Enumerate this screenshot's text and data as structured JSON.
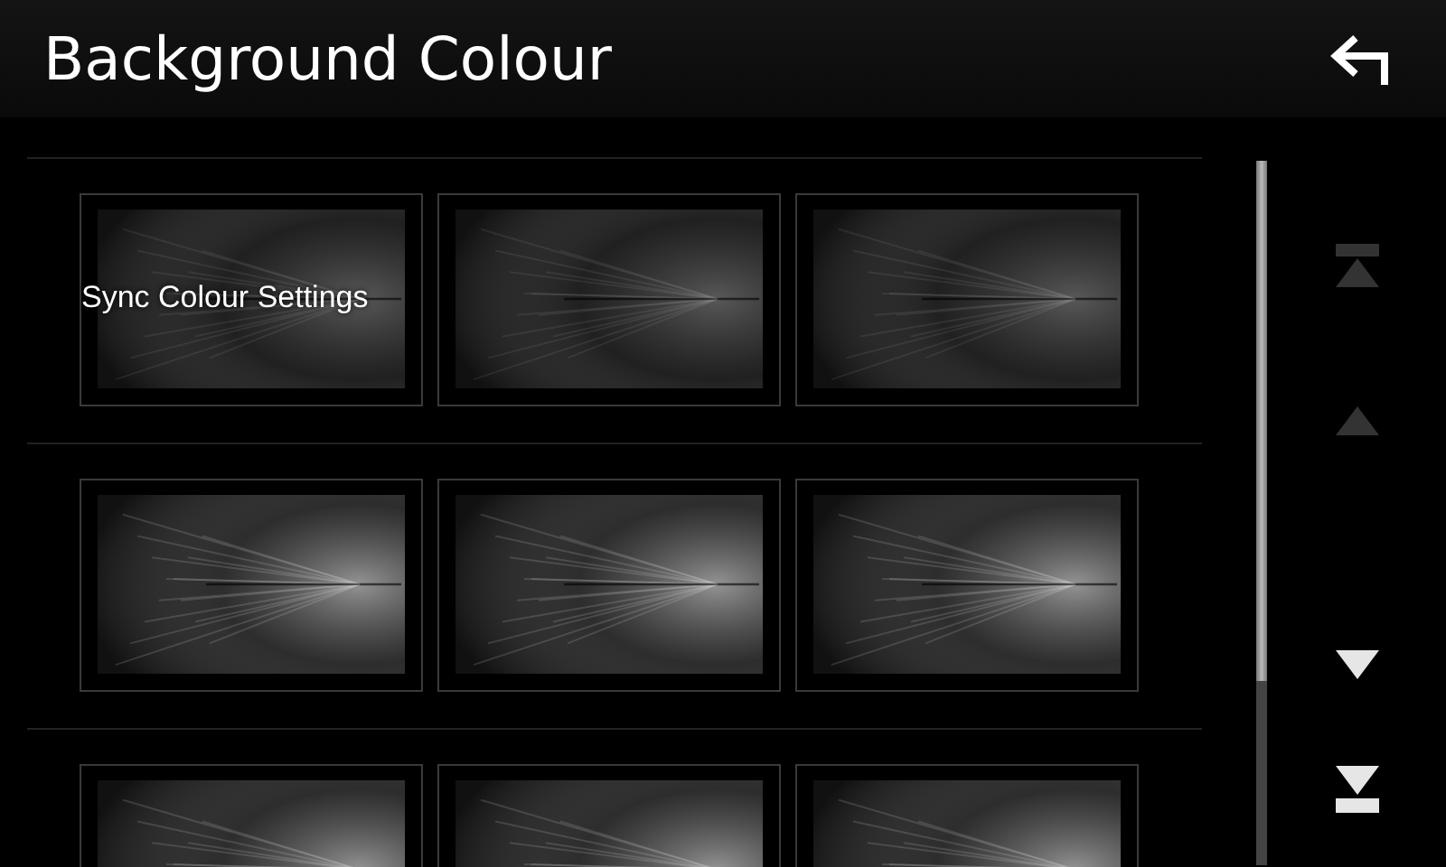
{
  "header": {
    "title": "Background Colour"
  },
  "rows": [
    {
      "tiles": [
        {
          "kind": "dim",
          "label": "Sync Colour Settings"
        },
        {
          "kind": "dim"
        },
        {
          "kind": "dim"
        }
      ]
    },
    {
      "tiles": [
        {
          "kind": "bright"
        },
        {
          "kind": "bright"
        },
        {
          "kind": "bright"
        }
      ]
    },
    {
      "tiles": [
        {
          "kind": "bright"
        },
        {
          "kind": "bright"
        },
        {
          "kind": "bright"
        }
      ]
    }
  ],
  "scroll_buttons": [
    {
      "kind": "top",
      "disabled": true
    },
    {
      "kind": "up",
      "disabled": true
    },
    {
      "kind": "down",
      "disabled": false
    },
    {
      "kind": "bottom",
      "disabled": false
    }
  ]
}
